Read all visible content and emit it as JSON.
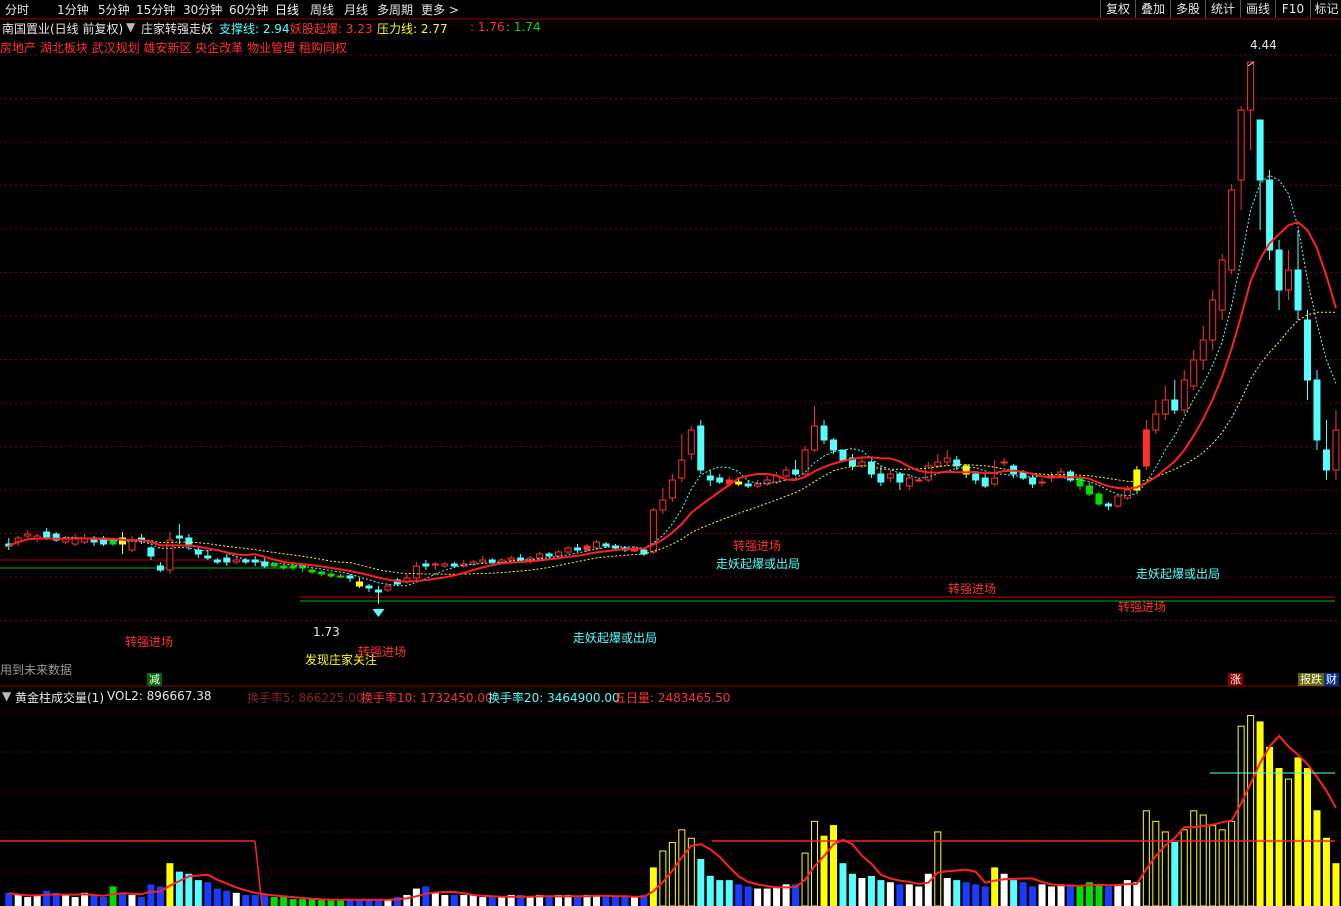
{
  "toolbar": {
    "periods": [
      "分时",
      "1分钟",
      "5分钟",
      "15分钟",
      "30分钟",
      "60分钟",
      "日线",
      "周线",
      "月线",
      "多周期",
      "更多 >"
    ],
    "active": "日线",
    "right_buttons": [
      "复权",
      "叠加",
      "多股",
      "统计",
      "画线",
      "F10",
      "标记"
    ]
  },
  "header": {
    "stock": "南国置业(日线 前复权)",
    "indicator_name": "庄家转强走妖",
    "support_label": "支撑线: 2.94",
    "yaoqi_label": "妖股起爆: 3.23",
    "pressure_label": "压力线: 2.77",
    "v1": ": 1.76",
    "v2": ": 1.74",
    "concepts": "房地产 湖北板块 武汉规划 雄安新区 央企改革 物业管理 租购同权"
  },
  "main_chart": {
    "high_label": "4.44",
    "low_label": "1.73",
    "future_note": "用到未来数据",
    "annotations": {
      "a1": "转强进场",
      "a2": "发现庄家关注",
      "a3": "转强进场",
      "a4": "走妖起爆或出局",
      "a5": "转强进场",
      "a6": "走妖起爆或出局",
      "a7": "转强进场",
      "a8": "走妖起爆或出局",
      "a9": "转强进场"
    },
    "badges": {
      "b1": "减",
      "b2": "涨",
      "b3": "报跌",
      "b4": "财"
    }
  },
  "volume_panel": {
    "name": "黄金柱成交量(1)",
    "vol2": "VOL2: 896667.38",
    "hs5": "换手率5: 866225.00",
    "hs10": "换手率10: 1732450.00",
    "hs20": "换手率20: 3464900.00",
    "w5": "五日量: 2483465.50"
  },
  "colors": {
    "up": "#ff3030",
    "down": "#54ffff",
    "gold": "#ffff00",
    "green": "#00dd00",
    "ma": "#ff2020"
  },
  "chart_data": {
    "type": "candlestick",
    "price_candles": [
      [
        2.03,
        2.02,
        2.06,
        2.0
      ],
      [
        2.04,
        2.06,
        2.07,
        2.02
      ],
      [
        2.07,
        2.08,
        2.1,
        2.05
      ],
      [
        2.06,
        2.07,
        2.08,
        2.04
      ],
      [
        2.09,
        2.06,
        2.11,
        2.05
      ],
      [
        2.08,
        2.05,
        2.09,
        2.04
      ],
      [
        2.04,
        2.06,
        2.07,
        2.03
      ],
      [
        2.03,
        2.06,
        2.08,
        2.02
      ],
      [
        2.04,
        2.06,
        2.08,
        2.03
      ],
      [
        2.06,
        2.04,
        2.07,
        2.02
      ],
      [
        2.06,
        2.03,
        2.07,
        2.02
      ],
      [
        2.03,
        2.05,
        2.06,
        2.02
      ],
      [
        2.06,
        2.03,
        2.09,
        1.98
      ],
      [
        2.0,
        2.05,
        2.07,
        1.99
      ],
      [
        2.06,
        2.05,
        2.08,
        2.03
      ],
      [
        2.01,
        1.97,
        2.02,
        1.95
      ],
      [
        1.92,
        1.9,
        1.94,
        1.89
      ],
      [
        1.9,
        2.05,
        2.09,
        1.88
      ],
      [
        2.07,
        2.06,
        2.13,
        2.03
      ],
      [
        2.06,
        2.03,
        2.08,
        2.0
      ],
      [
        2.0,
        1.98,
        2.02,
        1.96
      ],
      [
        1.97,
        1.96,
        2.0,
        1.95
      ],
      [
        1.95,
        1.94,
        1.96,
        1.93
      ],
      [
        1.96,
        1.94,
        1.98,
        1.92
      ],
      [
        1.94,
        1.95,
        1.97,
        1.93
      ],
      [
        1.95,
        1.94,
        1.96,
        1.93
      ],
      [
        1.95,
        1.94,
        1.97,
        1.92
      ],
      [
        1.94,
        1.92,
        1.96,
        1.91
      ],
      [
        1.93,
        1.92,
        1.94,
        1.91
      ],
      [
        1.92,
        1.91,
        1.93,
        1.9
      ],
      [
        1.91,
        1.92,
        1.93,
        1.9
      ],
      [
        1.92,
        1.91,
        1.93,
        1.89
      ],
      [
        1.9,
        1.89,
        1.91,
        1.88
      ],
      [
        1.89,
        1.88,
        1.9,
        1.87
      ],
      [
        1.88,
        1.87,
        1.89,
        1.86
      ],
      [
        1.87,
        1.87,
        1.88,
        1.86
      ],
      [
        1.87,
        1.86,
        1.88,
        1.84
      ],
      [
        1.84,
        1.82,
        1.86,
        1.81
      ],
      [
        1.82,
        1.81,
        1.83,
        1.79
      ],
      [
        1.8,
        1.79,
        1.82,
        1.73
      ],
      [
        1.8,
        1.82,
        1.83,
        1.79
      ],
      [
        1.85,
        1.83,
        1.86,
        1.82
      ],
      [
        1.84,
        1.86,
        1.88,
        1.83
      ],
      [
        1.86,
        1.92,
        1.94,
        1.85
      ],
      [
        1.93,
        1.92,
        1.95,
        1.9
      ],
      [
        1.93,
        1.93,
        1.94,
        1.9
      ],
      [
        1.92,
        1.93,
        1.94,
        1.91
      ],
      [
        1.93,
        1.92,
        1.94,
        1.91
      ],
      [
        1.92,
        1.93,
        1.95,
        1.91
      ],
      [
        1.93,
        1.94,
        1.95,
        1.92
      ],
      [
        1.94,
        1.95,
        1.97,
        1.93
      ],
      [
        1.95,
        1.94,
        1.96,
        1.93
      ],
      [
        1.94,
        1.95,
        1.96,
        1.93
      ],
      [
        1.95,
        1.96,
        1.97,
        1.94
      ],
      [
        1.96,
        1.95,
        1.98,
        1.94
      ],
      [
        1.95,
        1.96,
        1.97,
        1.93
      ],
      [
        1.96,
        1.98,
        1.99,
        1.95
      ],
      [
        1.98,
        1.97,
        1.99,
        1.96
      ],
      [
        1.97,
        1.99,
        2.0,
        1.96
      ],
      [
        1.99,
        2.01,
        2.02,
        1.98
      ],
      [
        2.01,
        2.0,
        2.03,
        1.99
      ],
      [
        2.0,
        2.02,
        2.03,
        1.99
      ],
      [
        2.01,
        2.04,
        2.05,
        2.0
      ],
      [
        2.03,
        2.02,
        2.04,
        2.01
      ],
      [
        2.02,
        2.01,
        2.03,
        2.0
      ],
      [
        2.01,
        2.0,
        2.02,
        1.99
      ],
      [
        2.0,
        2.0,
        2.02,
        1.99
      ],
      [
        2.0,
        1.98,
        2.01,
        1.97
      ],
      [
        1.99,
        2.2,
        2.21,
        1.98
      ],
      [
        2.2,
        2.25,
        2.31,
        2.18
      ],
      [
        2.26,
        2.35,
        2.38,
        2.24
      ],
      [
        2.36,
        2.45,
        2.58,
        2.34
      ],
      [
        2.48,
        2.6,
        2.62,
        2.45
      ],
      [
        2.62,
        2.4,
        2.65,
        2.38
      ],
      [
        2.37,
        2.35,
        2.4,
        2.32
      ],
      [
        2.36,
        2.34,
        2.38,
        2.33
      ],
      [
        2.35,
        2.33,
        2.37,
        2.32
      ],
      [
        2.34,
        2.33,
        2.36,
        2.32
      ],
      [
        2.33,
        2.32,
        2.35,
        2.31
      ],
      [
        2.32,
        2.33,
        2.35,
        2.31
      ],
      [
        2.33,
        2.35,
        2.37,
        2.32
      ],
      [
        2.34,
        2.37,
        2.39,
        2.33
      ],
      [
        2.37,
        2.4,
        2.42,
        2.36
      ],
      [
        2.4,
        2.38,
        2.45,
        2.37
      ],
      [
        2.38,
        2.5,
        2.52,
        2.37
      ],
      [
        2.5,
        2.62,
        2.72,
        2.49
      ],
      [
        2.62,
        2.55,
        2.65,
        2.53
      ],
      [
        2.55,
        2.5,
        2.56,
        2.48
      ],
      [
        2.5,
        2.45,
        2.5,
        2.44
      ],
      [
        2.46,
        2.42,
        2.48,
        2.4
      ],
      [
        2.42,
        2.44,
        2.46,
        2.41
      ],
      [
        2.44,
        2.38,
        2.45,
        2.36
      ],
      [
        2.38,
        2.34,
        2.42,
        2.32
      ],
      [
        2.36,
        2.38,
        2.4,
        2.34
      ],
      [
        2.38,
        2.34,
        2.39,
        2.3
      ],
      [
        2.32,
        2.36,
        2.38,
        2.3
      ],
      [
        2.35,
        2.35,
        2.36,
        2.34
      ],
      [
        2.35,
        2.42,
        2.44,
        2.34
      ],
      [
        2.42,
        2.44,
        2.48,
        2.41
      ],
      [
        2.44,
        2.46,
        2.5,
        2.42
      ],
      [
        2.45,
        2.42,
        2.47,
        2.4
      ],
      [
        2.42,
        2.38,
        2.43,
        2.36
      ],
      [
        2.38,
        2.35,
        2.39,
        2.33
      ],
      [
        2.36,
        2.32,
        2.38,
        2.31
      ],
      [
        2.33,
        2.36,
        2.45,
        2.32
      ],
      [
        2.44,
        2.44,
        2.46,
        2.42
      ],
      [
        2.42,
        2.38,
        2.43,
        2.36
      ],
      [
        2.39,
        2.36,
        2.4,
        2.35
      ],
      [
        2.36,
        2.33,
        2.38,
        2.31
      ],
      [
        2.34,
        2.34,
        2.36,
        2.32
      ],
      [
        2.36,
        2.37,
        2.39,
        2.34
      ],
      [
        2.37,
        2.39,
        2.41,
        2.36
      ],
      [
        2.39,
        2.35,
        2.4,
        2.34
      ],
      [
        2.36,
        2.32,
        2.37,
        2.3
      ],
      [
        2.32,
        2.28,
        2.34,
        2.27
      ],
      [
        2.28,
        2.23,
        2.29,
        2.22
      ],
      [
        2.23,
        2.22,
        2.24,
        2.2
      ],
      [
        2.22,
        2.27,
        2.28,
        2.21
      ],
      [
        2.26,
        2.3,
        2.32,
        2.25
      ],
      [
        2.3,
        2.4,
        2.42,
        2.29
      ],
      [
        2.42,
        2.6,
        2.65,
        2.4
      ],
      [
        2.6,
        2.68,
        2.75,
        2.58
      ],
      [
        2.68,
        2.75,
        2.82,
        2.65
      ],
      [
        2.75,
        2.7,
        2.85,
        2.68
      ],
      [
        2.7,
        2.85,
        2.9,
        2.68
      ],
      [
        2.82,
        2.95,
        3.0,
        2.8
      ],
      [
        2.95,
        3.05,
        3.12,
        2.9
      ],
      [
        3.05,
        3.25,
        3.3,
        3.0
      ],
      [
        3.2,
        3.45,
        3.48,
        3.15
      ],
      [
        3.4,
        3.8,
        3.83,
        3.38
      ],
      [
        3.85,
        4.2,
        4.22,
        3.7
      ],
      [
        4.2,
        4.44,
        4.44,
        4.0
      ],
      [
        4.15,
        3.85,
        4.1,
        3.6
      ],
      [
        3.85,
        3.5,
        3.9,
        3.45
      ],
      [
        3.5,
        3.3,
        3.55,
        3.2
      ],
      [
        3.3,
        3.4,
        3.5,
        3.25
      ],
      [
        3.4,
        3.2,
        3.6,
        3.15
      ],
      [
        3.15,
        2.85,
        3.2,
        2.75
      ],
      [
        2.85,
        2.55,
        2.9,
        2.5
      ],
      [
        2.5,
        2.4,
        2.65,
        2.35
      ],
      [
        2.4,
        2.6,
        2.7,
        2.35
      ]
    ],
    "volume": [
      0.6,
      0.5,
      0.4,
      0.5,
      0.7,
      0.6,
      0.5,
      0.4,
      0.6,
      0.5,
      0.4,
      0.9,
      0.6,
      0.5,
      0.4,
      1.0,
      0.9,
      2.0,
      1.6,
      1.5,
      1.2,
      1.1,
      0.8,
      0.7,
      0.6,
      0.5,
      0.5,
      0.5,
      0.4,
      0.4,
      0.3,
      0.3,
      0.3,
      0.3,
      0.3,
      0.3,
      0.3,
      0.3,
      0.3,
      0.3,
      0.3,
      0.4,
      0.5,
      0.8,
      0.9,
      0.6,
      0.5,
      0.5,
      0.5,
      0.5,
      0.4,
      0.4,
      0.4,
      0.5,
      0.5,
      0.4,
      0.5,
      0.4,
      0.5,
      0.5,
      0.4,
      0.5,
      0.5,
      0.5,
      0.4,
      0.4,
      0.4,
      0.5,
      1.8,
      2.6,
      3.0,
      3.6,
      3.2,
      2.2,
      1.4,
      1.2,
      1.2,
      1.0,
      0.9,
      0.8,
      0.8,
      0.9,
      1.0,
      1.0,
      2.5,
      4.0,
      3.3,
      3.8,
      2.0,
      1.5,
      1.3,
      1.4,
      1.2,
      1.1,
      1.0,
      1.0,
      0.9,
      1.5,
      3.5,
      1.3,
      1.2,
      1.1,
      1.0,
      0.9,
      1.8,
      1.5,
      1.2,
      1.1,
      0.9,
      1.0,
      0.9,
      1.0,
      1.0,
      0.9,
      1.1,
      1.0,
      0.9,
      1.0,
      1.2,
      1.1,
      4.5,
      4.0,
      3.5,
      3.0,
      3.6,
      4.5,
      4.3,
      3.8,
      3.6,
      4.0,
      8.5,
      9.0,
      8.7,
      7.5,
      6.5,
      6.0,
      7.0,
      6.5,
      4.5,
      3.2,
      2.0
    ],
    "price_ylim": [
      1.5,
      4.55
    ],
    "high": 4.44,
    "low": 1.73
  }
}
